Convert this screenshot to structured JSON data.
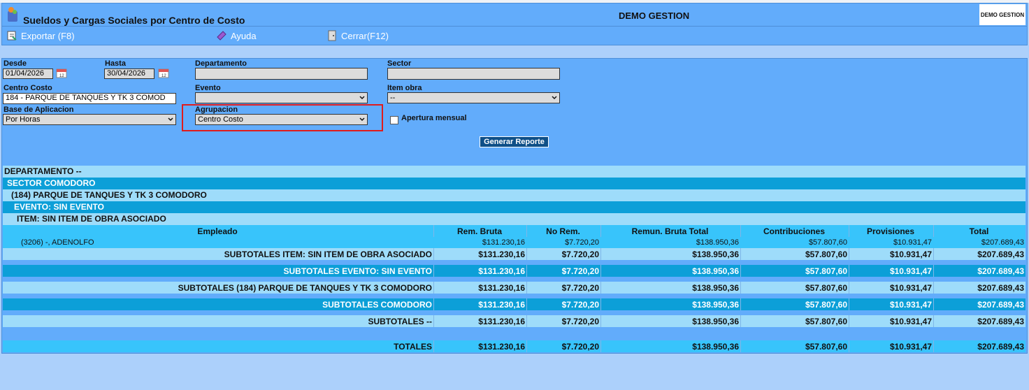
{
  "app": {
    "title": "Sueldos y Cargas Sociales por Centro de Costo",
    "company": "DEMO GESTION",
    "company_logo": "DEMO GESTION"
  },
  "toolbar": {
    "export": "Exportar (F8)",
    "help": "Ayuda",
    "close": "Cerrar(F12)"
  },
  "filters": {
    "desde_label": "Desde",
    "desde_value": "01/04/2026",
    "hasta_label": "Hasta",
    "hasta_value": "30/04/2026",
    "departamento_label": "Departamento",
    "departamento_value": "",
    "sector_label": "Sector",
    "sector_value": "",
    "centro_costo_label": "Centro Costo",
    "centro_costo_value": "184 - PARQUE DE TANQUES Y TK 3 COMOD",
    "evento_label": "Evento",
    "evento_value": "",
    "item_obra_label": "Item obra",
    "item_obra_value": "--",
    "base_label": "Base de Aplicacion",
    "base_value": "Por Horas",
    "agrupacion_label": "Agrupacion",
    "agrupacion_value": "Centro Costo",
    "apertura_label": "Apertura mensual",
    "generate_button": "Generar Reporte"
  },
  "report": {
    "departamento": "DEPARTAMENTO --",
    "sector": "SECTOR COMODORO",
    "centro": "(184) PARQUE DE TANQUES Y TK 3 COMODORO",
    "evento": "EVENTO: SIN EVENTO",
    "item": "ITEM: SIN ITEM DE OBRA ASOCIADO",
    "columns": [
      "Empleado",
      "Rem. Bruta",
      "No Rem.",
      "Remun. Bruta Total",
      "Contribuciones",
      "Provisiones",
      "Total"
    ],
    "employee": {
      "name": "(3206) -, ADENOLFO",
      "values": [
        "$131.230,16",
        "$7.720,20",
        "$138.950,36",
        "$57.807,60",
        "$10.931,47",
        "$207.689,43"
      ]
    },
    "subtotals": [
      {
        "label": "SUBTOTALES ITEM: SIN ITEM DE OBRA ASOCIADO",
        "values": [
          "$131.230,16",
          "$7.720,20",
          "$138.950,36",
          "$57.807,60",
          "$10.931,47",
          "$207.689,43"
        ]
      },
      {
        "label": "SUBTOTALES EVENTO: SIN EVENTO",
        "values": [
          "$131.230,16",
          "$7.720,20",
          "$138.950,36",
          "$57.807,60",
          "$10.931,47",
          "$207.689,43"
        ]
      },
      {
        "label": "SUBTOTALES (184) PARQUE DE TANQUES Y TK 3 COMODORO",
        "values": [
          "$131.230,16",
          "$7.720,20",
          "$138.950,36",
          "$57.807,60",
          "$10.931,47",
          "$207.689,43"
        ]
      },
      {
        "label": "SUBTOTALES COMODORO",
        "values": [
          "$131.230,16",
          "$7.720,20",
          "$138.950,36",
          "$57.807,60",
          "$10.931,47",
          "$207.689,43"
        ]
      },
      {
        "label": "SUBTOTALES --",
        "values": [
          "$131.230,16",
          "$7.720,20",
          "$138.950,36",
          "$57.807,60",
          "$10.931,47",
          "$207.689,43"
        ]
      }
    ],
    "totals": {
      "label": "TOTALES",
      "values": [
        "$131.230,16",
        "$7.720,20",
        "$138.950,36",
        "$57.807,60",
        "$10.931,47",
        "$207.689,43"
      ]
    }
  },
  "colors": {
    "header_bg": "#62acfb",
    "row_dark": "#0c9fd8",
    "row_light": "#9edcfa",
    "row_cyan": "#38c4fb",
    "highlight": "#e01b1b"
  }
}
